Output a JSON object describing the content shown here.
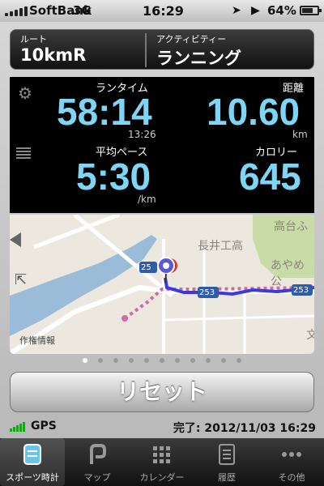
{
  "status_bar": {
    "carrier": "SoftBank",
    "network": "3G",
    "time": "16:29",
    "battery": "64%"
  },
  "route": {
    "route_label": "ルート",
    "route_value": "10kmR",
    "activity_label": "アクティビティー",
    "activity_value": "ランニング"
  },
  "stats": {
    "run_time_label": "ランタイム",
    "run_time": "58:14",
    "lap_time": "13:26",
    "distance_label": "距離",
    "distance": "10.60",
    "distance_unit": "km",
    "pace_label": "平均ペース",
    "pace": "5:30",
    "pace_unit": "/km",
    "calories_label": "カロリー",
    "calories": "645"
  },
  "map": {
    "places": [
      "長井工高",
      "高台ふ",
      "あやめ公",
      "文"
    ],
    "route_numbers": [
      "25",
      "253",
      "253"
    ],
    "copyright": "作権情報"
  },
  "pages": {
    "total": 11,
    "active": 0
  },
  "reset_button": "リセット",
  "footer": {
    "gps": "GPS",
    "completed": "完了: 2012/11/03 16:29"
  },
  "tabs": [
    {
      "label": "スポーツ時計",
      "icon": "stopwatch-icon",
      "active": true
    },
    {
      "label": "マップ",
      "icon": "map-icon",
      "active": false
    },
    {
      "label": "カレンダー",
      "icon": "calendar-icon",
      "active": false
    },
    {
      "label": "履歴",
      "icon": "history-icon",
      "active": false
    },
    {
      "label": "その他",
      "icon": "more-icon",
      "active": false
    }
  ],
  "colors": {
    "stat_value": "#7dd6f5",
    "route_line": "#3a3ae0",
    "gps_green": "#1aa31a"
  }
}
